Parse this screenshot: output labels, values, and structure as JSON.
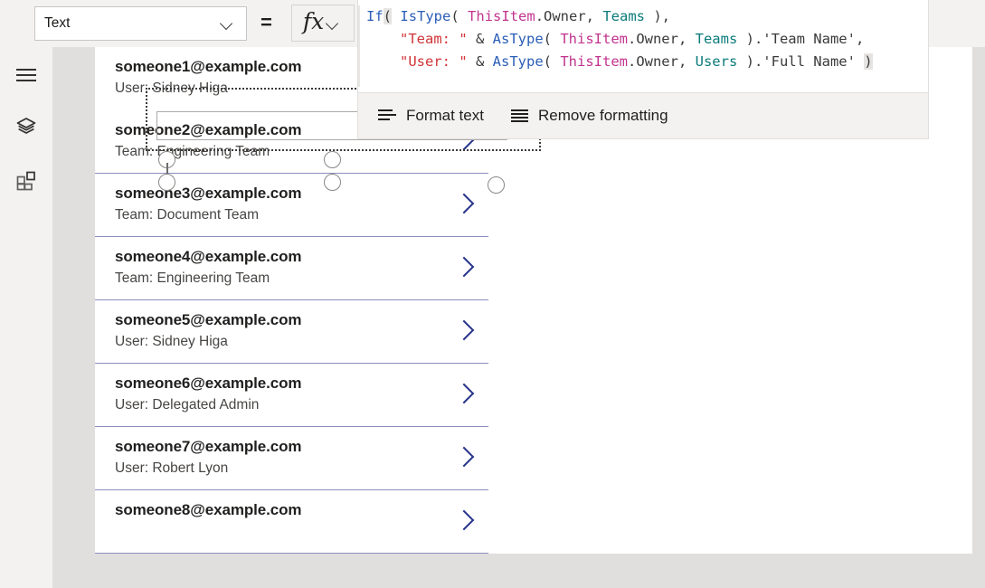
{
  "topbar": {
    "property_dropdown": {
      "selected": "Text",
      "icon": "chevron-down-icon"
    },
    "equals_sign": "=",
    "fx_button": {
      "glyph": "fx",
      "icon": "chevron-down-icon"
    }
  },
  "formula_bar": {
    "lines": [
      {
        "indent": false,
        "tokens": [
          {
            "text": "If",
            "kind": "fn"
          },
          {
            "text": "(",
            "kind": "hl"
          },
          {
            "text": " ",
            "kind": "plain"
          },
          {
            "text": "IsType",
            "kind": "fn"
          },
          {
            "text": "( ",
            "kind": "plain"
          },
          {
            "text": "ThisItem",
            "kind": "obj"
          },
          {
            "text": ".Owner, ",
            "kind": "plain"
          },
          {
            "text": "Teams",
            "kind": "ent"
          },
          {
            "text": " ),",
            "kind": "plain"
          }
        ]
      },
      {
        "indent": true,
        "tokens": [
          {
            "text": "\"Team: \"",
            "kind": "str"
          },
          {
            "text": " & ",
            "kind": "plain"
          },
          {
            "text": "AsType",
            "kind": "fn"
          },
          {
            "text": "( ",
            "kind": "plain"
          },
          {
            "text": "ThisItem",
            "kind": "obj"
          },
          {
            "text": ".Owner, ",
            "kind": "plain"
          },
          {
            "text": "Teams",
            "kind": "ent"
          },
          {
            "text": " ).'Team Name',",
            "kind": "plain"
          }
        ]
      },
      {
        "indent": true,
        "tokens": [
          {
            "text": "\"User: \"",
            "kind": "str"
          },
          {
            "text": " & ",
            "kind": "plain"
          },
          {
            "text": "AsType",
            "kind": "fn"
          },
          {
            "text": "( ",
            "kind": "plain"
          },
          {
            "text": "ThisItem",
            "kind": "obj"
          },
          {
            "text": ".Owner, ",
            "kind": "plain"
          },
          {
            "text": "Users",
            "kind": "ent"
          },
          {
            "text": " ).'Full Name' ",
            "kind": "plain"
          },
          {
            "text": ")",
            "kind": "hl"
          }
        ]
      }
    ],
    "plain_text": "If( IsType( ThisItem.Owner, Teams ),\n    \"Team: \" & AsType( ThisItem.Owner, Teams ).'Team Name',\n    \"User: \" & AsType( ThisItem.Owner, Users ).'Full Name' )"
  },
  "format_toolbar": {
    "items": [
      {
        "label": "Format text",
        "icon": "format-text-icon"
      },
      {
        "label": "Remove formatting",
        "icon": "remove-formatting-icon"
      }
    ]
  },
  "left_rail": {
    "items": [
      {
        "name": "menu",
        "icon": "hamburger-menu-icon"
      },
      {
        "name": "tree-view",
        "icon": "layers-icon"
      },
      {
        "name": "components",
        "icon": "components-grid-icon"
      }
    ]
  },
  "gallery": {
    "selected_index": 0,
    "chevron_icon": "chevron-right-icon",
    "rows": [
      {
        "title": "someone1@example.com",
        "subtitle": "User: Sidney Higa"
      },
      {
        "title": "someone2@example.com",
        "subtitle": "Team: Engineering Team"
      },
      {
        "title": "someone3@example.com",
        "subtitle": "Team: Document Team"
      },
      {
        "title": "someone4@example.com",
        "subtitle": "Team: Engineering Team"
      },
      {
        "title": "someone5@example.com",
        "subtitle": "User: Sidney Higa"
      },
      {
        "title": "someone6@example.com",
        "subtitle": "User: Delegated Admin"
      },
      {
        "title": "someone7@example.com",
        "subtitle": "User: Robert Lyon"
      },
      {
        "title": "someone8@example.com",
        "subtitle": ""
      }
    ]
  },
  "colors": {
    "chrome_bg": "#f3f2f1",
    "canvas_bg": "#e1dfdd",
    "app_bg": "#ffffff",
    "row_divider": "#8a8fbd",
    "chevron": "#27348b",
    "token_function": "#2b5eb8",
    "token_object": "#c2348f",
    "token_entity": "#0b7b7b",
    "token_string": "#d13438",
    "selection_outline": "#3b3a39"
  }
}
